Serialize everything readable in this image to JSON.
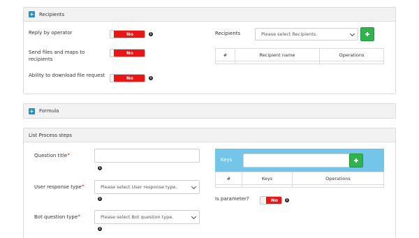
{
  "recipients_panel": {
    "title": "Recipients",
    "reply_label": "Reply by operator",
    "reply_value": "No",
    "send_files_label_line1": "Send files and maps to",
    "send_files_label_line2": "recipients",
    "send_files_value": "No",
    "download_label": "Ability to download file request",
    "download_value": "No",
    "recipients_label": "Recipients",
    "recipients_placeholder": "Please select Recipients.",
    "table_headers": [
      "#",
      "Recipient name",
      "Operations"
    ]
  },
  "formula_panel": {
    "title": "Formula"
  },
  "steps_panel": {
    "title": "List Process steps",
    "question_title_label": "Question title",
    "user_response_label": "User response type",
    "user_response_placeholder": "Please select User response type.",
    "bot_question_label": "Bot question type",
    "bot_question_placeholder": "Please select Bot question type.",
    "required_mark": "*",
    "keys_label": "Keys",
    "keys_table_headers": [
      "#",
      "Keys",
      "Operations"
    ],
    "is_parameter_label": "Is parameter?",
    "is_parameter_value": "No"
  },
  "icons": {
    "info": "i"
  },
  "colors": {
    "toggle_red": "#ea1616",
    "add_green": "#2fb34a",
    "keys_header_blue": "#74c5ea",
    "panel_icon_blue": "#2a8fc7"
  }
}
